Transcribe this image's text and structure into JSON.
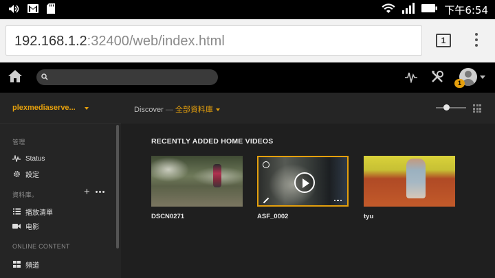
{
  "status_bar": {
    "time": "下午6:54"
  },
  "browser": {
    "url_host": "192.168.1.2",
    "url_rest": ":32400/web/index.html",
    "tab_count": "1"
  },
  "header": {
    "search_placeholder": "",
    "notification_count": "1"
  },
  "subheader": {
    "server_name": "plexmediaserve...",
    "breadcrumb_root": "Discover",
    "breadcrumb_sep": " — ",
    "breadcrumb_library": "全部資料庫"
  },
  "sidebar": {
    "manage_label": "管理",
    "manage_items": [
      {
        "label": "Status",
        "icon": "activity-icon"
      },
      {
        "label": "設定",
        "icon": "gear-icon"
      }
    ],
    "libraries_label": "資料庫。",
    "library_items": [
      {
        "label": "播放清單",
        "icon": "list-icon"
      },
      {
        "label": "电影",
        "icon": "video-camera-icon"
      }
    ],
    "online_label": "ONLINE CONTENT",
    "online_items": [
      {
        "label": "頻道",
        "icon": "grid-icon"
      }
    ]
  },
  "main": {
    "section_title": "RECENTLY ADDED HOME VIDEOS",
    "videos": [
      {
        "title": "DSCN0271"
      },
      {
        "title": "ASF_0002"
      },
      {
        "title": "tyu"
      }
    ]
  },
  "colors": {
    "accent": "#e5a00d",
    "background": "#1f1f1f",
    "sidebar": "#252525"
  }
}
